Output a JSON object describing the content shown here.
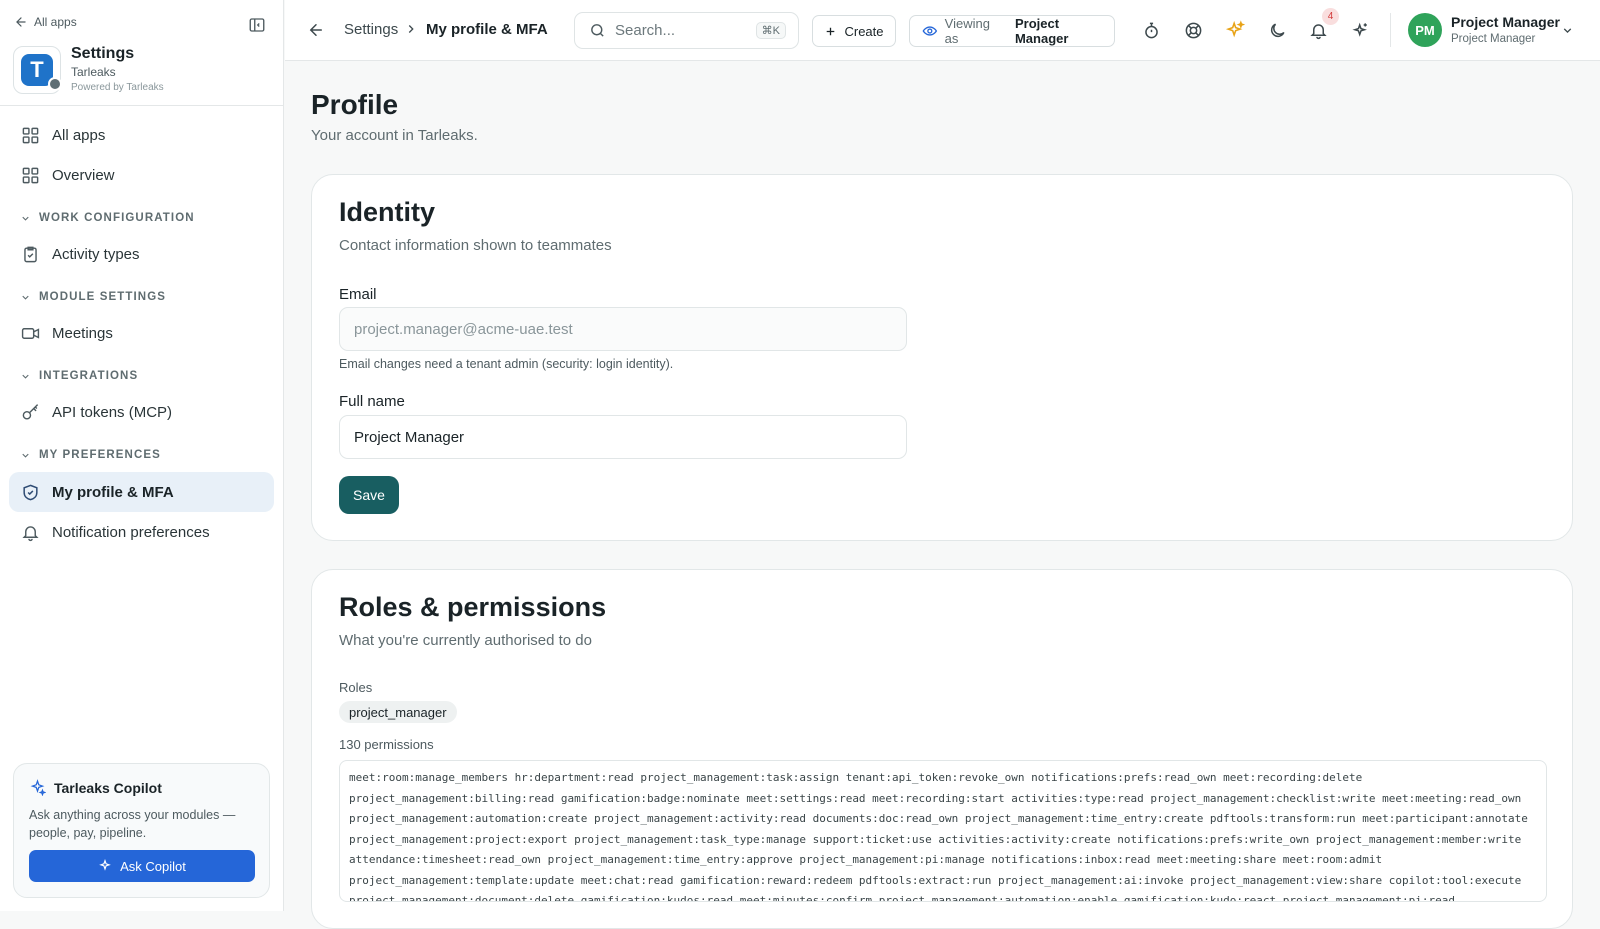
{
  "sidebar": {
    "back_label": "All apps",
    "app": {
      "name": "Settings",
      "tenant": "Tarleaks",
      "powered_by": "Powered by Tarleaks",
      "logo_letter": "T",
      "logo_color": "#1f73c9"
    },
    "items": {
      "all_apps": "All apps",
      "overview": "Overview",
      "activity_types": "Activity types",
      "meetings": "Meetings",
      "api_tokens": "API tokens (MCP)",
      "my_profile": "My profile & MFA",
      "notification_prefs": "Notification preferences"
    },
    "sections": {
      "work_config": "WORK CONFIGURATION",
      "module_settings": "MODULE SETTINGS",
      "integrations": "INTEGRATIONS",
      "my_preferences": "MY PREFERENCES"
    },
    "copilot": {
      "title": "Tarleaks Copilot",
      "description": "Ask anything across your modules — people, pay, pipeline.",
      "button": "Ask Copilot",
      "accent": "#2566d8"
    }
  },
  "header": {
    "breadcrumb_parent": "Settings",
    "breadcrumb_current": "My profile & MFA",
    "search_placeholder": "Search...",
    "search_shortcut": "⌘K",
    "create_label": "Create",
    "viewing_prefix": "Viewing as",
    "viewing_role": "Project Manager",
    "notification_count": "4",
    "user": {
      "initials": "PM",
      "name": "Project Manager",
      "role": "Project Manager",
      "avatar_color": "#2fa35a"
    }
  },
  "page": {
    "title": "Profile",
    "subtitle": "Your account in Tarleaks."
  },
  "identity": {
    "title": "Identity",
    "subtitle": "Contact information shown to teammates",
    "email_label": "Email",
    "email_value": "project.manager@acme-uae.test",
    "email_hint": "Email changes need a tenant admin (security: login identity).",
    "fullname_label": "Full name",
    "fullname_value": "Project Manager",
    "save_label": "Save",
    "save_color": "#185e61"
  },
  "roles": {
    "title": "Roles & permissions",
    "subtitle": "What you're currently authorised to do",
    "roles_label": "Roles",
    "role": "project_manager",
    "permission_count": "130 permissions",
    "permissions": "meet:room:manage_members hr:department:read project_management:task:assign tenant:api_token:revoke_own notifications:prefs:read_own meet:recording:delete project_management:billing:read gamification:badge:nominate meet:settings:read meet:recording:start activities:type:read project_management:checklist:write meet:meeting:read_own project_management:automation:create project_management:activity:read documents:doc:read_own project_management:time_entry:create pdftools:transform:run meet:participant:annotate project_management:project:export project_management:task_type:manage support:ticket:use activities:activity:create notifications:prefs:write_own project_management:member:write attendance:timesheet:read_own project_management:time_entry:approve project_management:pi:manage notifications:inbox:read meet:meeting:share meet:room:admit project_management:template:update meet:chat:read gamification:reward:redeem pdftools:extract:run project_management:ai:invoke project_management:view:share copilot:tool:execute project_management:document:delete gamification:kudos:read meet:minutes:confirm project_management:automation:enable gamification:kudo:react project_management:pi:read"
  }
}
